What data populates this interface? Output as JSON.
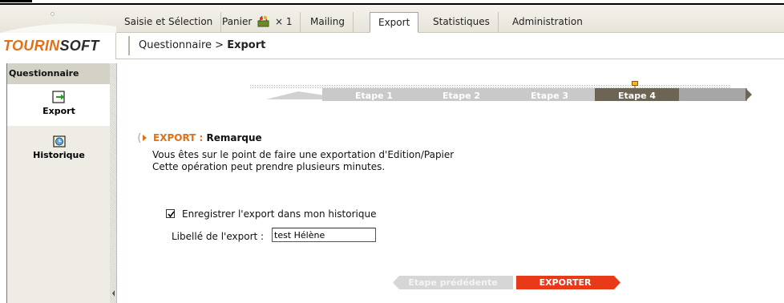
{
  "app": {
    "logo_part1": "TOURIN",
    "logo_part2": "SOFT",
    "brand_orange": "#e0701a"
  },
  "tabs": [
    {
      "label": "Saisie et Sélection"
    },
    {
      "label": "Panier",
      "suffix": "× 1",
      "icon": "basket-icon"
    },
    {
      "label": "Mailing"
    },
    {
      "label": "Export",
      "active": true
    },
    {
      "label": "Statistiques"
    },
    {
      "label": "Administration"
    }
  ],
  "breadcrumb": {
    "parent": "Questionnaire > ",
    "current": "Export"
  },
  "sidebar": {
    "title": "Questionnaire",
    "items": [
      {
        "label": "Export",
        "icon": "export-arrow-icon",
        "active": true
      },
      {
        "label": "Historique",
        "icon": "history-clock-icon",
        "active": false
      }
    ]
  },
  "steps": [
    {
      "label": "Etape 1"
    },
    {
      "label": "Etape 2"
    },
    {
      "label": "Etape 3"
    },
    {
      "label": "Etape 4",
      "active": true
    }
  ],
  "section": {
    "title_prefix": "EXPORT : ",
    "title": "Remarque",
    "line1": "Vous êtes sur le point de faire une exportation d'Edition/Papier",
    "line2": "Cette opération peut prendre plusieurs minutes."
  },
  "form": {
    "save_history_label": "Enregistrer l'export dans mon historique",
    "save_history_checked": true,
    "label_field_label": "Libellé de l'export :",
    "label_field_value": "test Hélène"
  },
  "buttons": {
    "previous": "Etape prédédente",
    "export": "EXPORTER"
  }
}
